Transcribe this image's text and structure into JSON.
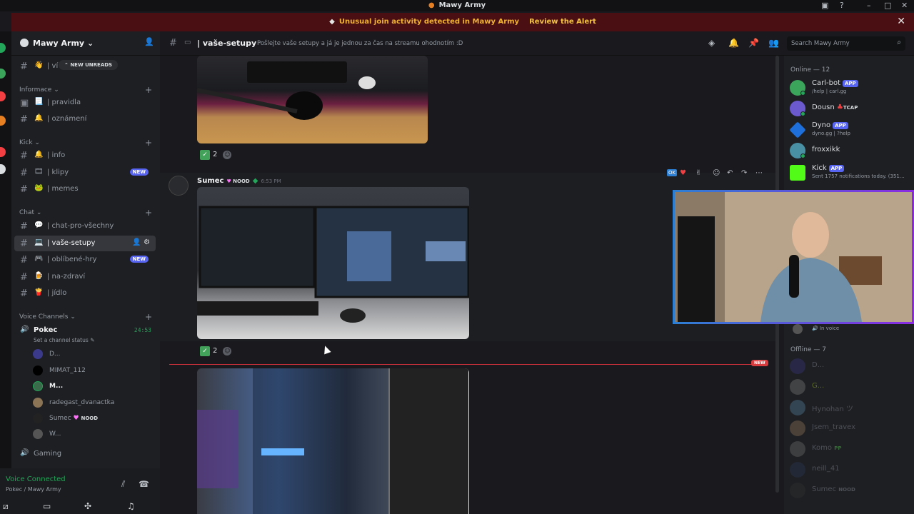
{
  "window": {
    "title": "Mawy Army"
  },
  "alert": {
    "message": "Unusual join activity detected in Mawy Army",
    "action": "Review the Alert"
  },
  "server": {
    "name": "Mawy Army"
  },
  "sidebar": {
    "new_unreads": "NEW UNREADS",
    "top_channel": {
      "emoji": "👋",
      "label": "| ví"
    },
    "categories": [
      {
        "name": "Informace",
        "channels": [
          {
            "emoji": "📃",
            "label": "| pravidla"
          },
          {
            "emoji": "🔔",
            "label": "| oznámení"
          }
        ]
      },
      {
        "name": "Kick",
        "channels": [
          {
            "emoji": "🔔",
            "label": "| info"
          },
          {
            "emoji": "🎞",
            "label": "| klipy",
            "badge": "NEW"
          },
          {
            "emoji": "🐸",
            "label": "| memes"
          }
        ]
      },
      {
        "name": "Chat",
        "channels": [
          {
            "emoji": "💬",
            "label": "| chat-pro-všechny"
          },
          {
            "emoji": "💻",
            "label": "| vaše-setupy",
            "active": true
          },
          {
            "emoji": "🎮",
            "label": "| oblíbené-hry",
            "badge": "NEW"
          },
          {
            "emoji": "🍺",
            "label": "| na-zdraví"
          },
          {
            "emoji": "🍟",
            "label": "| jídlo"
          }
        ]
      }
    ],
    "voice_category": "Voice Channels",
    "voice_channel": {
      "name": "Pokec",
      "timer": "24:53",
      "status": "Set a channel status"
    },
    "voice_users": [
      {
        "name": "D..."
      },
      {
        "name": "MIMAT_112"
      },
      {
        "name": "M..."
      },
      {
        "name": "radegast_dvanactka"
      },
      {
        "name": "Sumec",
        "tag": "NOOD"
      },
      {
        "name": "W..."
      }
    ],
    "voice_channel_2": "Gaming"
  },
  "voice_panel": {
    "status": "Voice Connected",
    "location": "Pokec / Mawy Army"
  },
  "topbar": {
    "channel": "vaše-setupy",
    "topic": "Pošlejte vaše setupy a já je jednou za čas na streamu ohodnotím :D",
    "search_placeholder": "Search Mawy Army"
  },
  "messages": {
    "reaction1": "2",
    "author": "Sumec",
    "author_tag": "NOOD",
    "timestamp": "6:53 PM",
    "reaction2": "2",
    "new_label": "NEW",
    "toolbar_ok": "OK"
  },
  "members": {
    "online_header": "Online — 12",
    "online": [
      {
        "name": "Carl-bot",
        "badge": "APP",
        "sub": "/help | carl.gg",
        "color": "#3ba55c"
      },
      {
        "name": "Dousn",
        "badge": "TCAP",
        "sub": "",
        "color": "#6a5acd"
      },
      {
        "name": "Dyno",
        "badge": "APP",
        "sub": "dyno.gg | ?help",
        "color": "#1e6fd9"
      },
      {
        "name": "froxxikk",
        "badge": "",
        "sub": "",
        "color": "#4a90a4"
      },
      {
        "name": "Kick",
        "badge": "APP",
        "sub": "Sent 1757 notifications today. (351...",
        "color": "#53fc18"
      }
    ],
    "in_voice": "In voice",
    "offline_header": "Offline — 7",
    "offline": [
      {
        "name": "D..."
      },
      {
        "name": "G..."
      },
      {
        "name": "Hynohan ツ"
      },
      {
        "name": "Jsem_travex"
      },
      {
        "name": "Komo",
        "tag": "PP"
      },
      {
        "name": "neill_41"
      },
      {
        "name": "Sumec",
        "tag": "NOOD"
      }
    ]
  },
  "colors": {
    "accent": "#5865f2",
    "online": "#23a55a",
    "alert_bg": "#4a0f12",
    "alert_text": "#f0b232",
    "new_line": "#c9303a"
  }
}
